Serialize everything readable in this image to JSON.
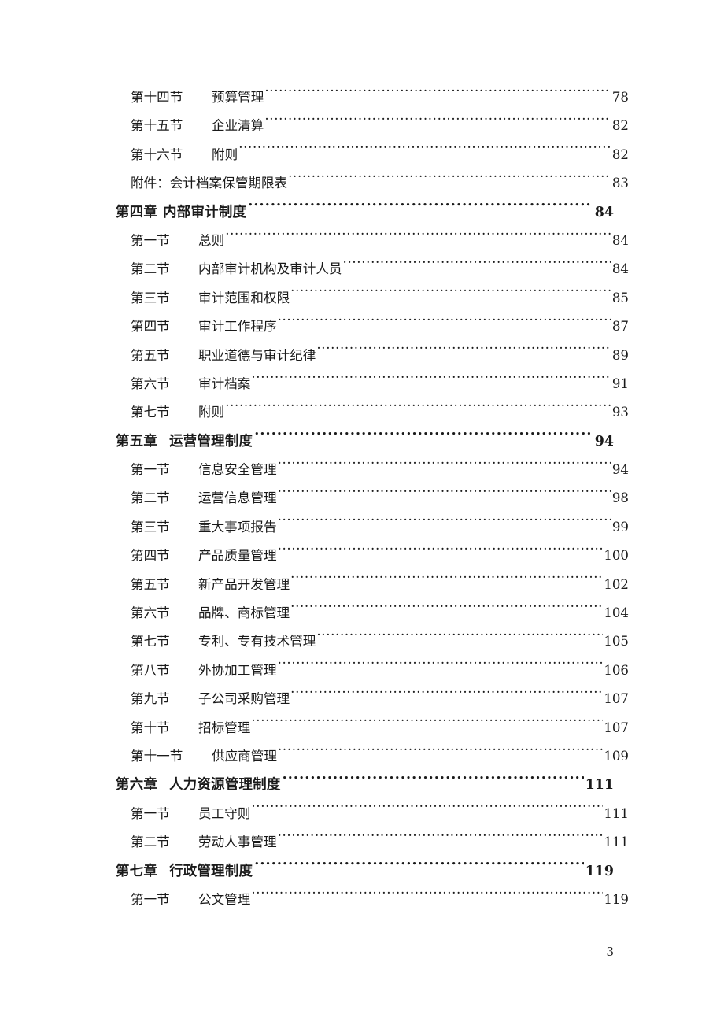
{
  "document": {
    "footer_page_number": "3"
  },
  "toc": {
    "entries": [
      {
        "kind": "section",
        "label": "第十四节",
        "title": "预算管理",
        "page": "78"
      },
      {
        "kind": "section",
        "label": "第十五节",
        "title": "企业清算",
        "page": "82"
      },
      {
        "kind": "section",
        "label": "第十六节",
        "title": "附则",
        "page": "82"
      },
      {
        "kind": "plain",
        "label": "",
        "title": "附件：会计档案保管期限表",
        "page": "83"
      },
      {
        "kind": "chapter",
        "label": "第四章",
        "title": "内部审计制度",
        "page": "84"
      },
      {
        "kind": "section",
        "label": "第一节",
        "title": "总则",
        "page": "84"
      },
      {
        "kind": "section",
        "label": "第二节",
        "title": "内部审计机构及审计人员",
        "page": "84"
      },
      {
        "kind": "section",
        "label": "第三节",
        "title": "审计范围和权限",
        "page": "85"
      },
      {
        "kind": "section",
        "label": "第四节",
        "title": "审计工作程序",
        "page": "87"
      },
      {
        "kind": "section",
        "label": "第五节",
        "title": "职业道德与审计纪律",
        "page": "89"
      },
      {
        "kind": "section",
        "label": "第六节",
        "title": "审计档案",
        "page": "91"
      },
      {
        "kind": "section",
        "label": "第七节",
        "title": "附则",
        "page": "93"
      },
      {
        "kind": "chapter",
        "label": "第五章",
        "title": "运营管理制度",
        "page": "94"
      },
      {
        "kind": "section",
        "label": "第一节",
        "title": "信息安全管理",
        "page": "94"
      },
      {
        "kind": "section",
        "label": "第二节",
        "title": "运营信息管理",
        "page": "98"
      },
      {
        "kind": "section",
        "label": "第三节",
        "title": "重大事项报告",
        "page": "99"
      },
      {
        "kind": "section",
        "label": "第四节",
        "title": "产品质量管理",
        "page": "100"
      },
      {
        "kind": "section",
        "label": "第五节",
        "title": "新产品开发管理",
        "page": "102"
      },
      {
        "kind": "section",
        "label": "第六节",
        "title": "品牌、商标管理",
        "page": "104"
      },
      {
        "kind": "section",
        "label": "第七节",
        "title": "专利、专有技术管理",
        "page": "105"
      },
      {
        "kind": "section",
        "label": "第八节",
        "title": "外协加工管理",
        "page": "106"
      },
      {
        "kind": "section",
        "label": "第九节",
        "title": "子公司采购管理",
        "page": "107"
      },
      {
        "kind": "section",
        "label": "第十节",
        "title": "招标管理",
        "page": "107"
      },
      {
        "kind": "section",
        "label": "第十一节",
        "title": "供应商管理",
        "page": "109"
      },
      {
        "kind": "chapter",
        "label": "第六章",
        "title": "人力资源管理制度",
        "page": "111"
      },
      {
        "kind": "section",
        "label": "第一节",
        "title": "员工守则",
        "page": "111"
      },
      {
        "kind": "section",
        "label": "第二节",
        "title": "劳动人事管理",
        "page": "111"
      },
      {
        "kind": "chapter",
        "label": "第七章",
        "title": "行政管理制度",
        "page": "119"
      },
      {
        "kind": "section",
        "label": "第一节",
        "title": "公文管理",
        "page": "119"
      }
    ]
  }
}
